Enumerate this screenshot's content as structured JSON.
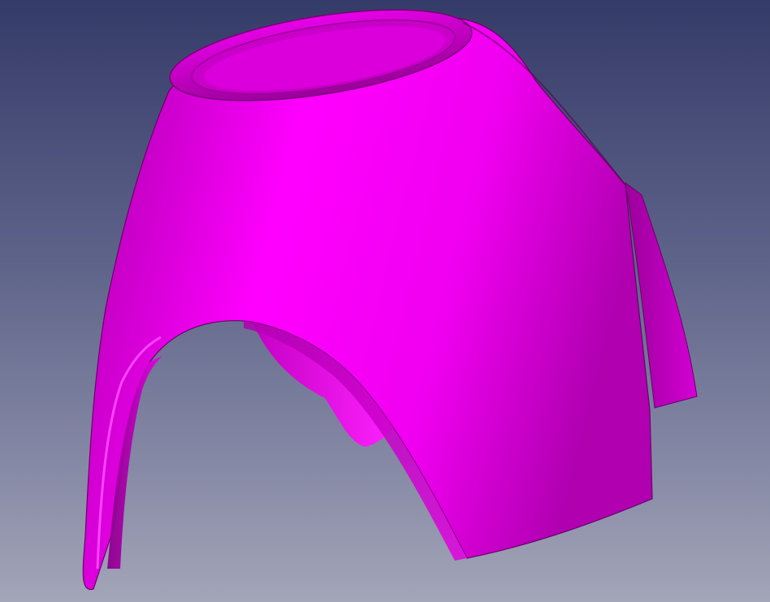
{
  "viewport": {
    "background_top": "#353B68",
    "background_mid": "#5C6288",
    "background_bottom": "#A3A5B8"
  },
  "model": {
    "shape": "curved shell with circular top opening and arched cut-out",
    "color": "#FF00FF",
    "shade_color": "#B000B0",
    "dark_color": "#7A007A",
    "highlight_color": "#FF33FF"
  }
}
